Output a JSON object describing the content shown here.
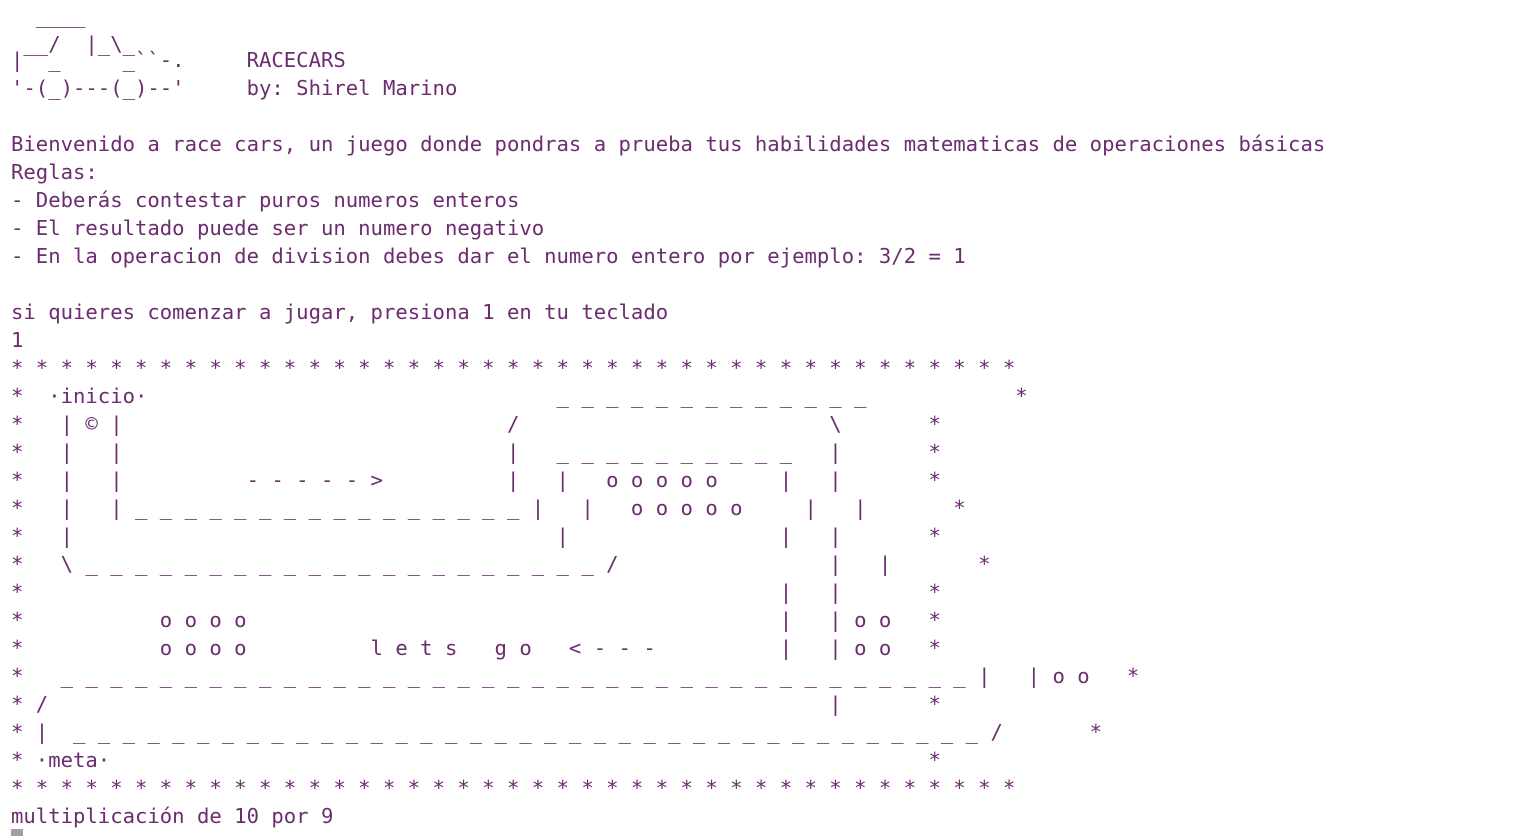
{
  "theme": {
    "text_color": "#6b2d6f",
    "background": "#ffffff",
    "cursor_color": "#a0a0a0"
  },
  "lines": [
    "  ____",
    " __/  |_\\_",
    "|  _     _``-.     RACECARS",
    "'-(_)---(_)--'     by: Shirel Marino",
    "",
    "Bienvenido a race cars, un juego donde pondras a prueba tus habilidades matematicas de operaciones básicas",
    "Reglas:",
    "- Deberás contestar puros numeros enteros",
    "- El resultado puede ser un numero negativo",
    "- En la operacion de division debes dar el numero entero por ejemplo: 3/2 = 1",
    "",
    "si quieres comenzar a jugar, presiona 1 en tu teclado",
    "1",
    "* * * * * * * * * * * * * * * * * * * * * * * * * * * * * * * * * * * * * * * * *",
    "*  ·inicio·                                 _ _ _ _ _ _ _ _ _ _ _ _ _            *",
    "*   | © |                               /                         \\       *",
    "*   |   |                               |   _ _ _ _ _ _ _ _ _ _   |       *",
    "*   |   |          - - - - - >          |   |   o o o o o     |   |       *",
    "*   |   | _ _ _ _ _ _ _ _ _ _ _ _ _ _ _ _ |   |   o o o o o     |   |       *",
    "*   |                                       |                 |   |       *",
    "*   \\ _ _ _ _ _ _ _ _ _ _ _ _ _ _ _ _ _ _ _ _ _ /                 |   |       *",
    "*                                                             |   |       *",
    "*           o o o o                                           |   | o o   *",
    "*           o o o o          l e t s   g o   < - - -          |   | o o   *",
    "*   _ _ _ _ _ _ _ _ _ _ _ _ _ _ _ _ _ _ _ _ _ _ _ _ _ _ _ _ _ _ _ _ _ _ _ _ _ |   | o o   *",
    "* /                                                               |       *",
    "* |  _ _ _ _ _ _ _ _ _ _ _ _ _ _ _ _ _ _ _ _ _ _ _ _ _ _ _ _ _ _ _ _ _ _ _ _ _ /       *",
    "* ·meta·                                                                  *",
    "* * * * * * * * * * * * * * * * * * * * * * * * * * * * * * * * * * * * * * * * *",
    "multiplicación de 10 por 9"
  ]
}
